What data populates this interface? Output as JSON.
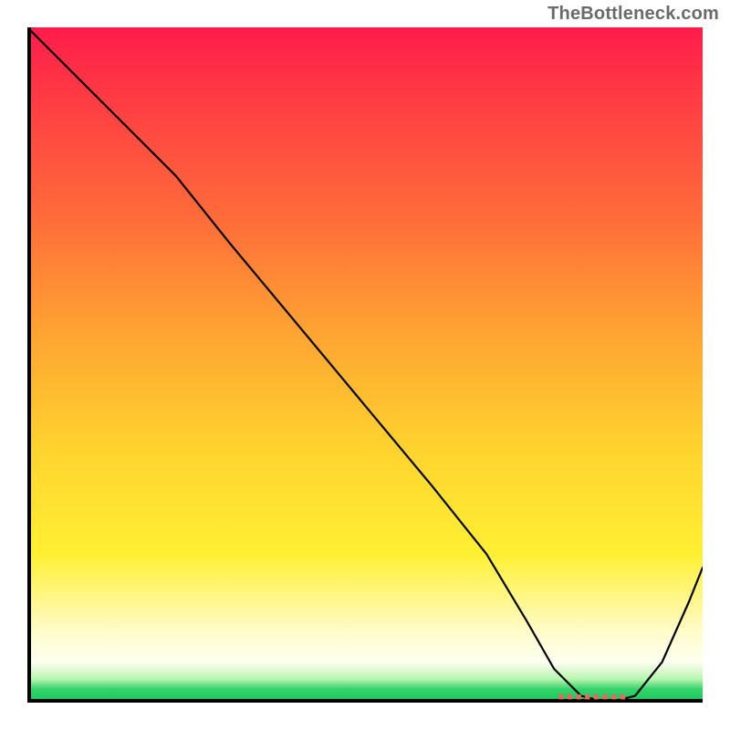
{
  "watermark": "TheBottleneck.com",
  "chart_data": {
    "type": "line",
    "title": "",
    "xlabel": "",
    "ylabel": "",
    "xlim": [
      0,
      100
    ],
    "ylim": [
      0,
      100
    ],
    "x": [
      0,
      8,
      15,
      22,
      30,
      40,
      50,
      60,
      68,
      74,
      78,
      82,
      86,
      90,
      94,
      98,
      100
    ],
    "values": [
      100,
      92,
      85,
      78,
      68,
      56,
      44,
      32,
      22,
      12,
      5,
      1,
      0,
      1,
      6,
      15,
      20
    ],
    "marker": {
      "label": "■■■■■■■■",
      "x_start": 78,
      "x_end": 90,
      "y": 0
    },
    "gradient_stops": [
      {
        "pct": 0,
        "color": "#ff1c4b"
      },
      {
        "pct": 10,
        "color": "#ff3a44"
      },
      {
        "pct": 28,
        "color": "#ff6b3a"
      },
      {
        "pct": 45,
        "color": "#ffa332"
      },
      {
        "pct": 62,
        "color": "#ffd22e"
      },
      {
        "pct": 78,
        "color": "#fff033"
      },
      {
        "pct": 90,
        "color": "#fffccf"
      },
      {
        "pct": 94,
        "color": "#fdfff0"
      },
      {
        "pct": 96.5,
        "color": "#b8f5b0"
      },
      {
        "pct": 98,
        "color": "#35d26a"
      },
      {
        "pct": 100,
        "color": "#18c85f"
      }
    ]
  }
}
